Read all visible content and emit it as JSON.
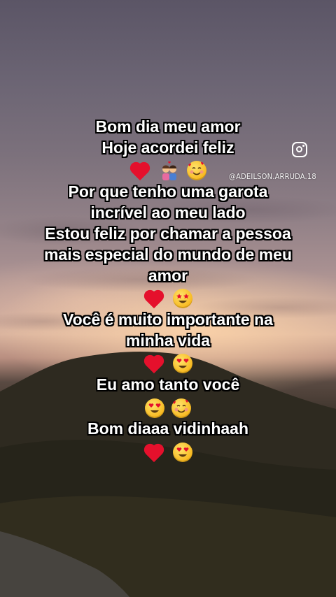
{
  "watermark": {
    "icon": "instagram-icon",
    "handle": "@ADEILSON.ARRUDA.18"
  },
  "message": {
    "lines": [
      "Bom dia meu amor",
      "Hoje acordei feliz",
      "Por que tenho uma garota",
      "incrível ao meu lado",
      "Estou feliz por chamar a pessoa",
      "mais especial do mundo de meu",
      "amor",
      "Você é muito importante na",
      "minha vida",
      "Eu amo tanto você",
      "Bom diaaa vidinhaah"
    ],
    "emoji_rows": [
      [
        "red-heart",
        "couple-with-heart",
        "smiling-face-with-hearts"
      ],
      [
        "red-heart",
        "star-struck"
      ],
      [
        "red-heart",
        "heart-eyes"
      ],
      [
        "heart-eyes",
        "smiling-face-with-hearts"
      ],
      [
        "red-heart",
        "heart-eyes"
      ]
    ]
  },
  "colors": {
    "text": "#ffffff",
    "text_outline": "#000000",
    "heart": "#e5102c",
    "emoji_face": "#f7b51a"
  }
}
